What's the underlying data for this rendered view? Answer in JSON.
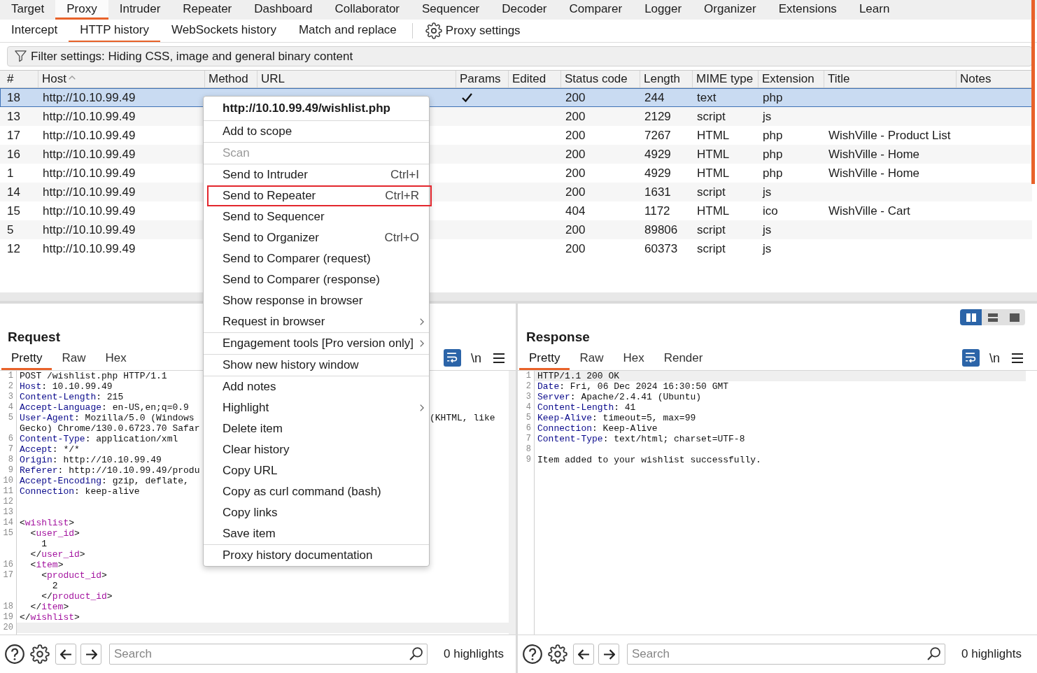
{
  "top_tabs": [
    {
      "label": "Target",
      "selected": false
    },
    {
      "label": "Proxy",
      "selected": true
    },
    {
      "label": "Intruder",
      "selected": false
    },
    {
      "label": "Repeater",
      "selected": false
    },
    {
      "label": "Dashboard",
      "selected": false
    },
    {
      "label": "Collaborator",
      "selected": false
    },
    {
      "label": "Sequencer",
      "selected": false
    },
    {
      "label": "Decoder",
      "selected": false
    },
    {
      "label": "Comparer",
      "selected": false
    },
    {
      "label": "Logger",
      "selected": false
    },
    {
      "label": "Organizer",
      "selected": false
    },
    {
      "label": "Extensions",
      "selected": false
    },
    {
      "label": "Learn",
      "selected": false
    }
  ],
  "sub_tabs": [
    {
      "label": "Intercept",
      "selected": false
    },
    {
      "label": "HTTP history",
      "selected": true
    },
    {
      "label": "WebSockets history",
      "selected": false
    },
    {
      "label": "Match and replace",
      "selected": false
    }
  ],
  "settings_button": {
    "label": "Proxy settings"
  },
  "filter_bar": {
    "text": "Filter settings: Hiding CSS, image and general binary content"
  },
  "history_table": {
    "columns": [
      {
        "label": "#",
        "sorted": false
      },
      {
        "label": "Host",
        "sorted": true
      },
      {
        "label": "Method",
        "sorted": false
      },
      {
        "label": "URL",
        "sorted": false
      },
      {
        "label": "Params",
        "sorted": false
      },
      {
        "label": "Edited",
        "sorted": false
      },
      {
        "label": "Status code",
        "sorted": false
      },
      {
        "label": "Length",
        "sorted": false
      },
      {
        "label": "MIME type",
        "sorted": false
      },
      {
        "label": "Extension",
        "sorted": false
      },
      {
        "label": "Title",
        "sorted": false
      },
      {
        "label": "Notes",
        "sorted": false
      }
    ],
    "rows": [
      {
        "number": "18",
        "host": "http://10.10.99.49",
        "params": true,
        "status_code": "200",
        "length": "244",
        "mime_type": "text",
        "extension": "php",
        "selected": true
      },
      {
        "number": "13",
        "host": "http://10.10.99.49",
        "params": false,
        "status_code": "200",
        "length": "2129",
        "mime_type": "script",
        "extension": "js",
        "selected": false
      },
      {
        "number": "17",
        "host": "http://10.10.99.49",
        "params": false,
        "status_code": "200",
        "length": "7267",
        "mime_type": "HTML",
        "extension": "php",
        "title": "WishVille - Product List",
        "selected": false
      },
      {
        "number": "16",
        "host": "http://10.10.99.49",
        "params": false,
        "status_code": "200",
        "length": "4929",
        "mime_type": "HTML",
        "extension": "php",
        "title": "WishVille - Home",
        "selected": false
      },
      {
        "number": "1",
        "host": "http://10.10.99.49",
        "params": false,
        "status_code": "200",
        "length": "4929",
        "mime_type": "HTML",
        "extension": "php",
        "title": "WishVille - Home",
        "selected": false
      },
      {
        "number": "14",
        "host": "http://10.10.99.49",
        "params": false,
        "status_code": "200",
        "length": "1631",
        "mime_type": "script",
        "extension": "js",
        "selected": false
      },
      {
        "number": "15",
        "host": "http://10.10.99.49",
        "params": false,
        "status_code": "404",
        "length": "1172",
        "mime_type": "HTML",
        "extension": "ico",
        "title": "WishVille - Cart",
        "selected": false
      },
      {
        "number": "5",
        "host": "http://10.10.99.49",
        "params": false,
        "status_code": "200",
        "length": "89806",
        "mime_type": "script",
        "extension": "js",
        "selected": false
      },
      {
        "number": "12",
        "host": "http://10.10.99.49",
        "params": false,
        "status_code": "200",
        "length": "60373",
        "mime_type": "script",
        "extension": "js",
        "selected": false
      }
    ]
  },
  "context_menu": {
    "title": "http://10.10.99.49/wishlist.php",
    "groups": [
      [
        {
          "label": "Add to scope",
          "disabled": false,
          "submenu": false,
          "highlighted": false
        }
      ],
      [
        {
          "label": "Scan",
          "disabled": true,
          "submenu": false,
          "highlighted": false
        }
      ],
      [
        {
          "label": "Send to Intruder",
          "shortcut": "Ctrl+I",
          "disabled": false,
          "submenu": false,
          "highlighted": false
        },
        {
          "label": "Send to Repeater",
          "shortcut": "Ctrl+R",
          "disabled": false,
          "submenu": false,
          "highlighted": true
        },
        {
          "label": "Send to Sequencer",
          "disabled": false,
          "submenu": false,
          "highlighted": false
        },
        {
          "label": "Send to Organizer",
          "shortcut": "Ctrl+O",
          "disabled": false,
          "submenu": false,
          "highlighted": false
        },
        {
          "label": "Send to Comparer (request)",
          "disabled": false,
          "submenu": false,
          "highlighted": false
        },
        {
          "label": "Send to Comparer (response)",
          "disabled": false,
          "submenu": false,
          "highlighted": false
        },
        {
          "label": "Show response in browser",
          "disabled": false,
          "submenu": false,
          "highlighted": false
        },
        {
          "label": "Request in browser",
          "disabled": false,
          "submenu": true,
          "highlighted": false
        }
      ],
      [
        {
          "label": "Engagement tools [Pro version only]",
          "disabled": false,
          "submenu": true,
          "highlighted": false
        }
      ],
      [
        {
          "label": "Show new history window",
          "disabled": false,
          "submenu": false,
          "highlighted": false
        }
      ],
      [
        {
          "label": "Add notes",
          "disabled": false,
          "submenu": false,
          "highlighted": false
        },
        {
          "label": "Highlight",
          "disabled": false,
          "submenu": true,
          "highlighted": false
        },
        {
          "label": "Delete item",
          "disabled": false,
          "submenu": false,
          "highlighted": false
        },
        {
          "label": "Clear history",
          "disabled": false,
          "submenu": false,
          "highlighted": false
        },
        {
          "label": "Copy URL",
          "disabled": false,
          "submenu": false,
          "highlighted": false
        },
        {
          "label": "Copy as curl command (bash)",
          "disabled": false,
          "submenu": false,
          "highlighted": false
        },
        {
          "label": "Copy links",
          "disabled": false,
          "submenu": false,
          "highlighted": false
        },
        {
          "label": "Save item",
          "disabled": false,
          "submenu": false,
          "highlighted": false
        }
      ],
      [
        {
          "label": "Proxy history documentation",
          "disabled": false,
          "submenu": false,
          "highlighted": false
        }
      ]
    ]
  },
  "request_pane": {
    "title": "Request",
    "tabs": [
      {
        "label": "Pretty",
        "selected": true
      },
      {
        "label": "Raw",
        "selected": false
      },
      {
        "label": "Hex",
        "selected": false
      }
    ],
    "wrap_on": true,
    "newline_label": "\\n",
    "lines": [
      {
        "number": "1",
        "kind": "text",
        "value": "POST /wishlist.php HTTP/1.1",
        "current": false
      },
      {
        "number": "2",
        "kind": "header",
        "key": "Host",
        "value": ": 10.10.99.49",
        "current": false
      },
      {
        "number": "3",
        "kind": "header",
        "key": "Content-Length",
        "value": ": 215",
        "current": false
      },
      {
        "number": "4",
        "kind": "header",
        "key": "Accept-Language",
        "value": ": en-US,en;q=0.9",
        "current": false
      },
      {
        "number": "5",
        "kind": "header",
        "key": "User-Agent",
        "value": ": Mozilla/5.0 (Windows",
        "tail": "(KHTML, like",
        "current": false
      },
      {
        "kind": "text",
        "value": "Gecko) Chrome/130.0.6723.70 Safar",
        "current": false
      },
      {
        "number": "6",
        "kind": "header",
        "key": "Content-Type",
        "value": ": application/xml",
        "current": false
      },
      {
        "number": "7",
        "kind": "header",
        "key": "Accept",
        "value": ": */*",
        "current": false
      },
      {
        "number": "8",
        "kind": "header",
        "key": "Origin",
        "value": ": http://10.10.99.49",
        "current": false
      },
      {
        "number": "9",
        "kind": "header",
        "key": "Referer",
        "value": ": http://10.10.99.49/produ",
        "current": false
      },
      {
        "number": "10",
        "kind": "header",
        "key": "Accept-Encoding",
        "value": ": gzip, deflate,",
        "current": false
      },
      {
        "number": "11",
        "kind": "header",
        "key": "Connection",
        "value": ": keep-alive",
        "current": false
      },
      {
        "number": "12",
        "kind": "blank",
        "current": false
      },
      {
        "number": "13",
        "kind": "blank",
        "current": false
      },
      {
        "number": "14",
        "kind": "tag",
        "prefix": "<",
        "tag": "wishlist",
        "suffix": ">",
        "current": false
      },
      {
        "number": "15",
        "kind": "tag",
        "prefix": "  <",
        "tag": "user_id",
        "suffix": ">",
        "current": false
      },
      {
        "kind": "text",
        "value": "    1",
        "current": false
      },
      {
        "kind": "tag",
        "prefix": "  </",
        "tag": "user_id",
        "suffix": ">",
        "current": false
      },
      {
        "number": "16",
        "kind": "tag",
        "prefix": "  <",
        "tag": "item",
        "suffix": ">",
        "current": false
      },
      {
        "number": "17",
        "kind": "tag",
        "prefix": "    <",
        "tag": "product_id",
        "suffix": ">",
        "current": false
      },
      {
        "kind": "text",
        "value": "      2",
        "current": false
      },
      {
        "kind": "tag",
        "prefix": "    </",
        "tag": "product_id",
        "suffix": ">",
        "current": false
      },
      {
        "number": "18",
        "kind": "tag",
        "prefix": "  </",
        "tag": "item",
        "suffix": ">",
        "current": false
      },
      {
        "number": "19",
        "kind": "tag",
        "prefix": "</",
        "tag": "wishlist",
        "suffix": ">",
        "current": false
      },
      {
        "number": "20",
        "kind": "blank",
        "current": true
      }
    ],
    "search": {
      "placeholder": "Search"
    },
    "highlights": "0 highlights"
  },
  "response_pane": {
    "title": "Response",
    "view_toggle": [
      {
        "kind": "columns",
        "selected": true
      },
      {
        "kind": "rows",
        "selected": false
      },
      {
        "kind": "single",
        "selected": false
      }
    ],
    "tabs": [
      {
        "label": "Pretty",
        "selected": true
      },
      {
        "label": "Raw",
        "selected": false
      },
      {
        "label": "Hex",
        "selected": false
      },
      {
        "label": "Render",
        "selected": false
      }
    ],
    "wrap_on": true,
    "newline_label": "\\n",
    "lines": [
      {
        "number": "1",
        "kind": "text",
        "value": "HTTP/1.1 200 OK",
        "current": true
      },
      {
        "number": "2",
        "kind": "header",
        "key": "Date",
        "value": ": Fri, 06 Dec 2024 16:30:50 GMT",
        "current": false
      },
      {
        "number": "3",
        "kind": "header",
        "key": "Server",
        "value": ": Apache/2.4.41 (Ubuntu)",
        "current": false
      },
      {
        "number": "4",
        "kind": "header",
        "key": "Content-Length",
        "value": ": 41",
        "current": false
      },
      {
        "number": "5",
        "kind": "header",
        "key": "Keep-Alive",
        "value": ": timeout=5, max=99",
        "current": false
      },
      {
        "number": "6",
        "kind": "header",
        "key": "Connection",
        "value": ": Keep-Alive",
        "current": false
      },
      {
        "number": "7",
        "kind": "header",
        "key": "Content-Type",
        "value": ": text/html; charset=UTF-8",
        "current": false
      },
      {
        "number": "8",
        "kind": "blank",
        "current": false
      },
      {
        "number": "9",
        "kind": "text",
        "value": "Item added to your wishlist successfully.",
        "current": false
      }
    ],
    "search": {
      "placeholder": "Search"
    },
    "highlights": "0 highlights"
  }
}
